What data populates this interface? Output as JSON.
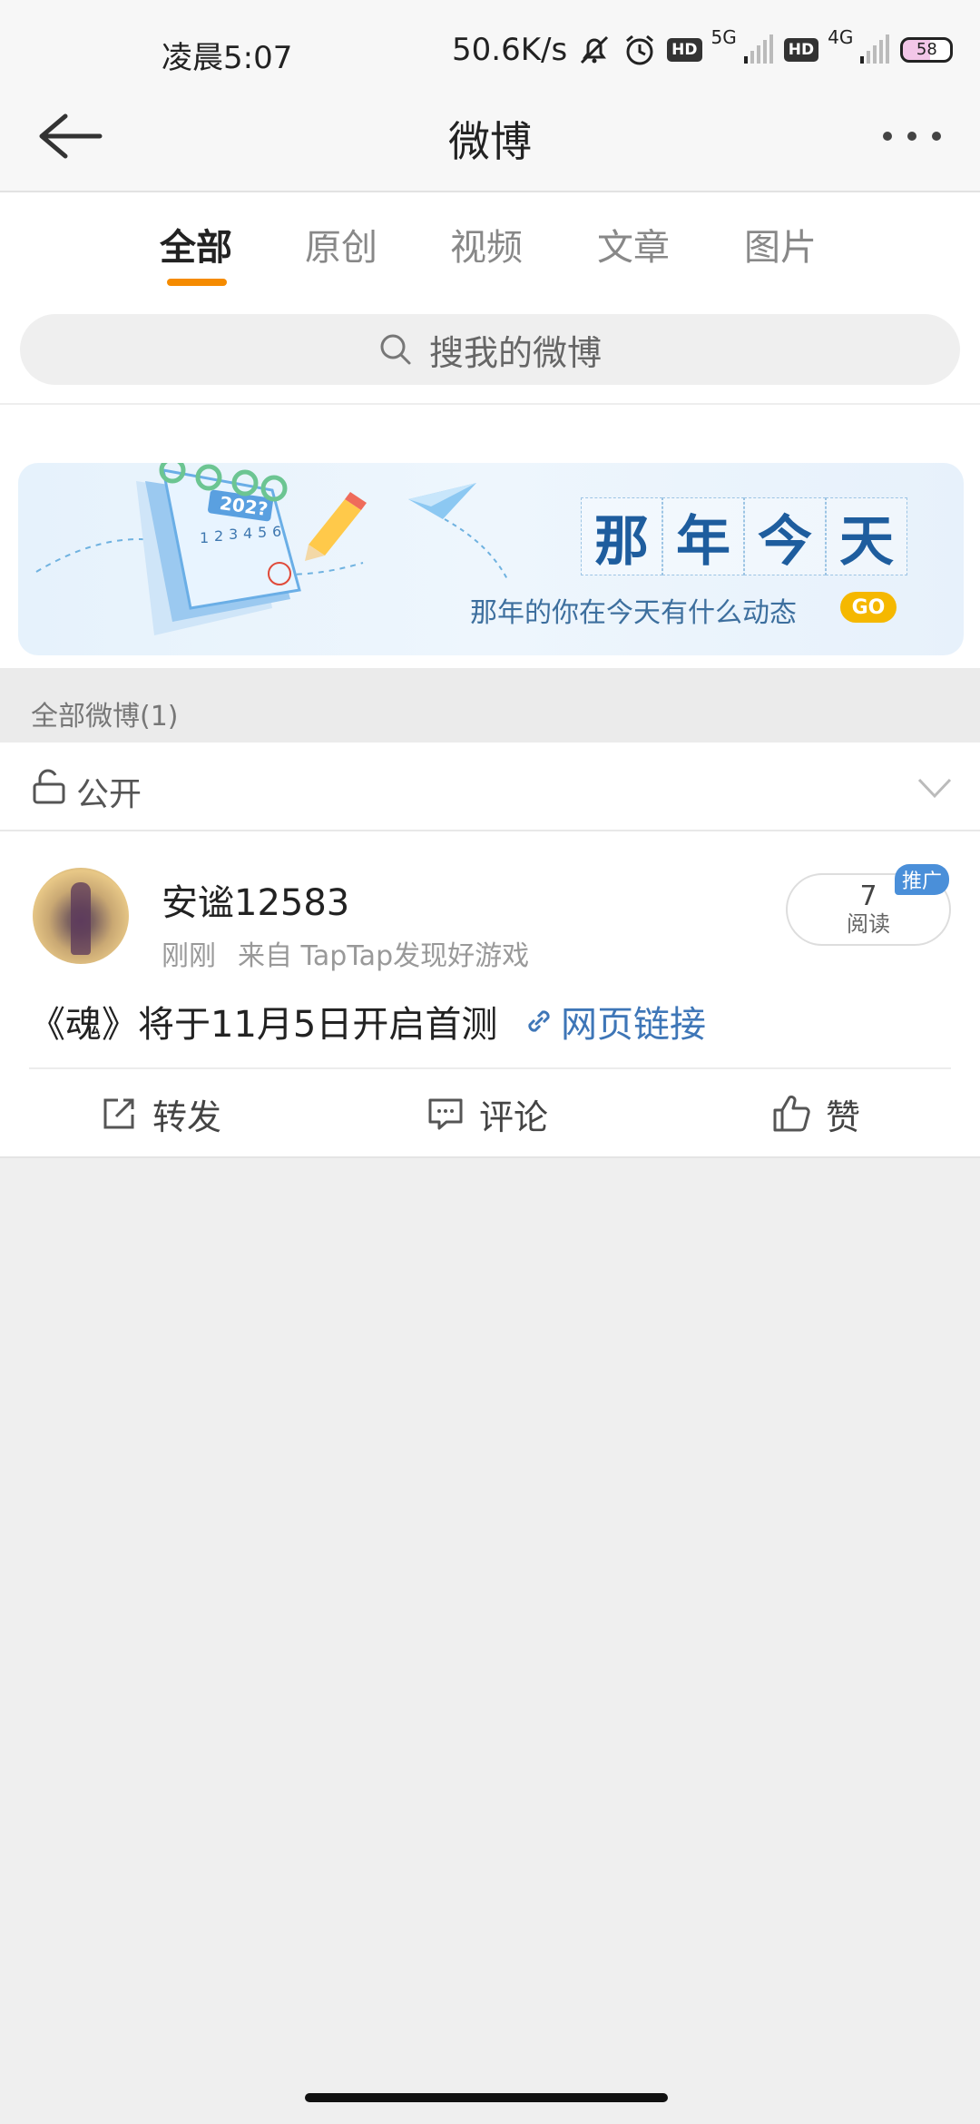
{
  "status_bar": {
    "time": "凌晨5:07",
    "net_speed": "50.6K/s",
    "sim1_net": "5G",
    "sim2_net": "4G",
    "hd_label": "HD",
    "battery": "58"
  },
  "nav": {
    "title": "微博"
  },
  "tabs": [
    {
      "label": "全部",
      "active": true
    },
    {
      "label": "原创",
      "active": false
    },
    {
      "label": "视频",
      "active": false
    },
    {
      "label": "文章",
      "active": false
    },
    {
      "label": "图片",
      "active": false
    }
  ],
  "search": {
    "placeholder": "搜我的微博"
  },
  "banner": {
    "calendar_year": "202?",
    "title_chars": [
      "那",
      "年",
      "今",
      "天"
    ],
    "subtitle": "那年的你在今天有什么动态",
    "go_label": "GO"
  },
  "section": {
    "header": "全部微博(1)"
  },
  "visibility": {
    "label": "公开"
  },
  "post": {
    "username": "安谧12583",
    "time": "刚刚",
    "source": "来自 TapTap发现好游戏",
    "read_count": "7",
    "read_label": "阅读",
    "promo_label": "推广",
    "text": "《魂》将于11月5日开启首测",
    "link_label": "网页链接",
    "actions": {
      "repost": "转发",
      "comment": "评论",
      "like": "赞"
    }
  },
  "colors": {
    "accent": "#f58b00",
    "link": "#3e76b7",
    "promo": "#4a8fd9"
  }
}
